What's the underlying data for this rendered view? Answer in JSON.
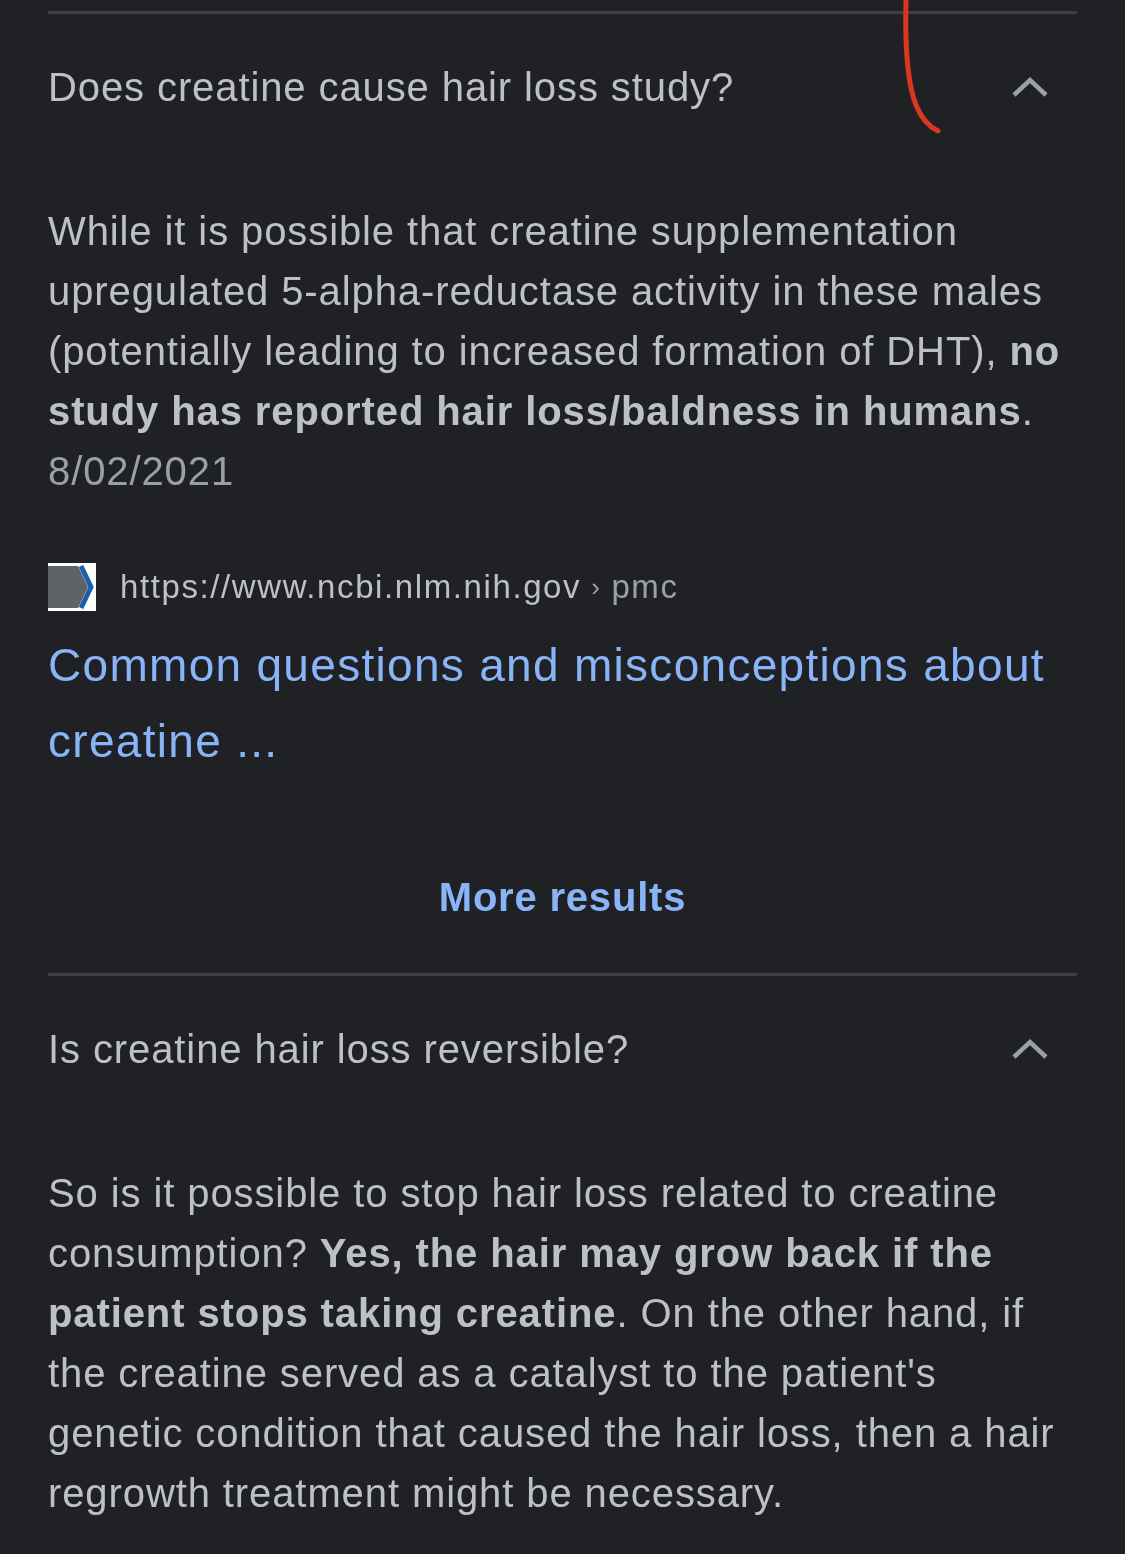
{
  "faqs": [
    {
      "question": "Does creatine cause hair loss study?",
      "expanded": true,
      "answer": "While it is possible that creatine supplementation upregulated 5-alpha-reductase activity in these males (potentially leading to increased formation of DHT), **no study has reported hair loss/baldness in humans**.",
      "date": "8/02/2021",
      "source": {
        "url": "https://www.ncbi.nlm.nih.gov",
        "separator": "›",
        "path": "pmc",
        "title": "Common questions and misconceptions about creatine ..."
      },
      "more_results": "More results"
    },
    {
      "question": "Is creatine hair loss reversible?",
      "expanded": true,
      "answer": "So is it possible to stop hair loss related to creatine consumption? **Yes, the hair may grow back if the patient stops taking creatine**. On the other hand, if the creatine served as a catalyst to the patient's genetic condition that caused the hair loss, then a hair regrowth treatment might be necessary."
    }
  ]
}
